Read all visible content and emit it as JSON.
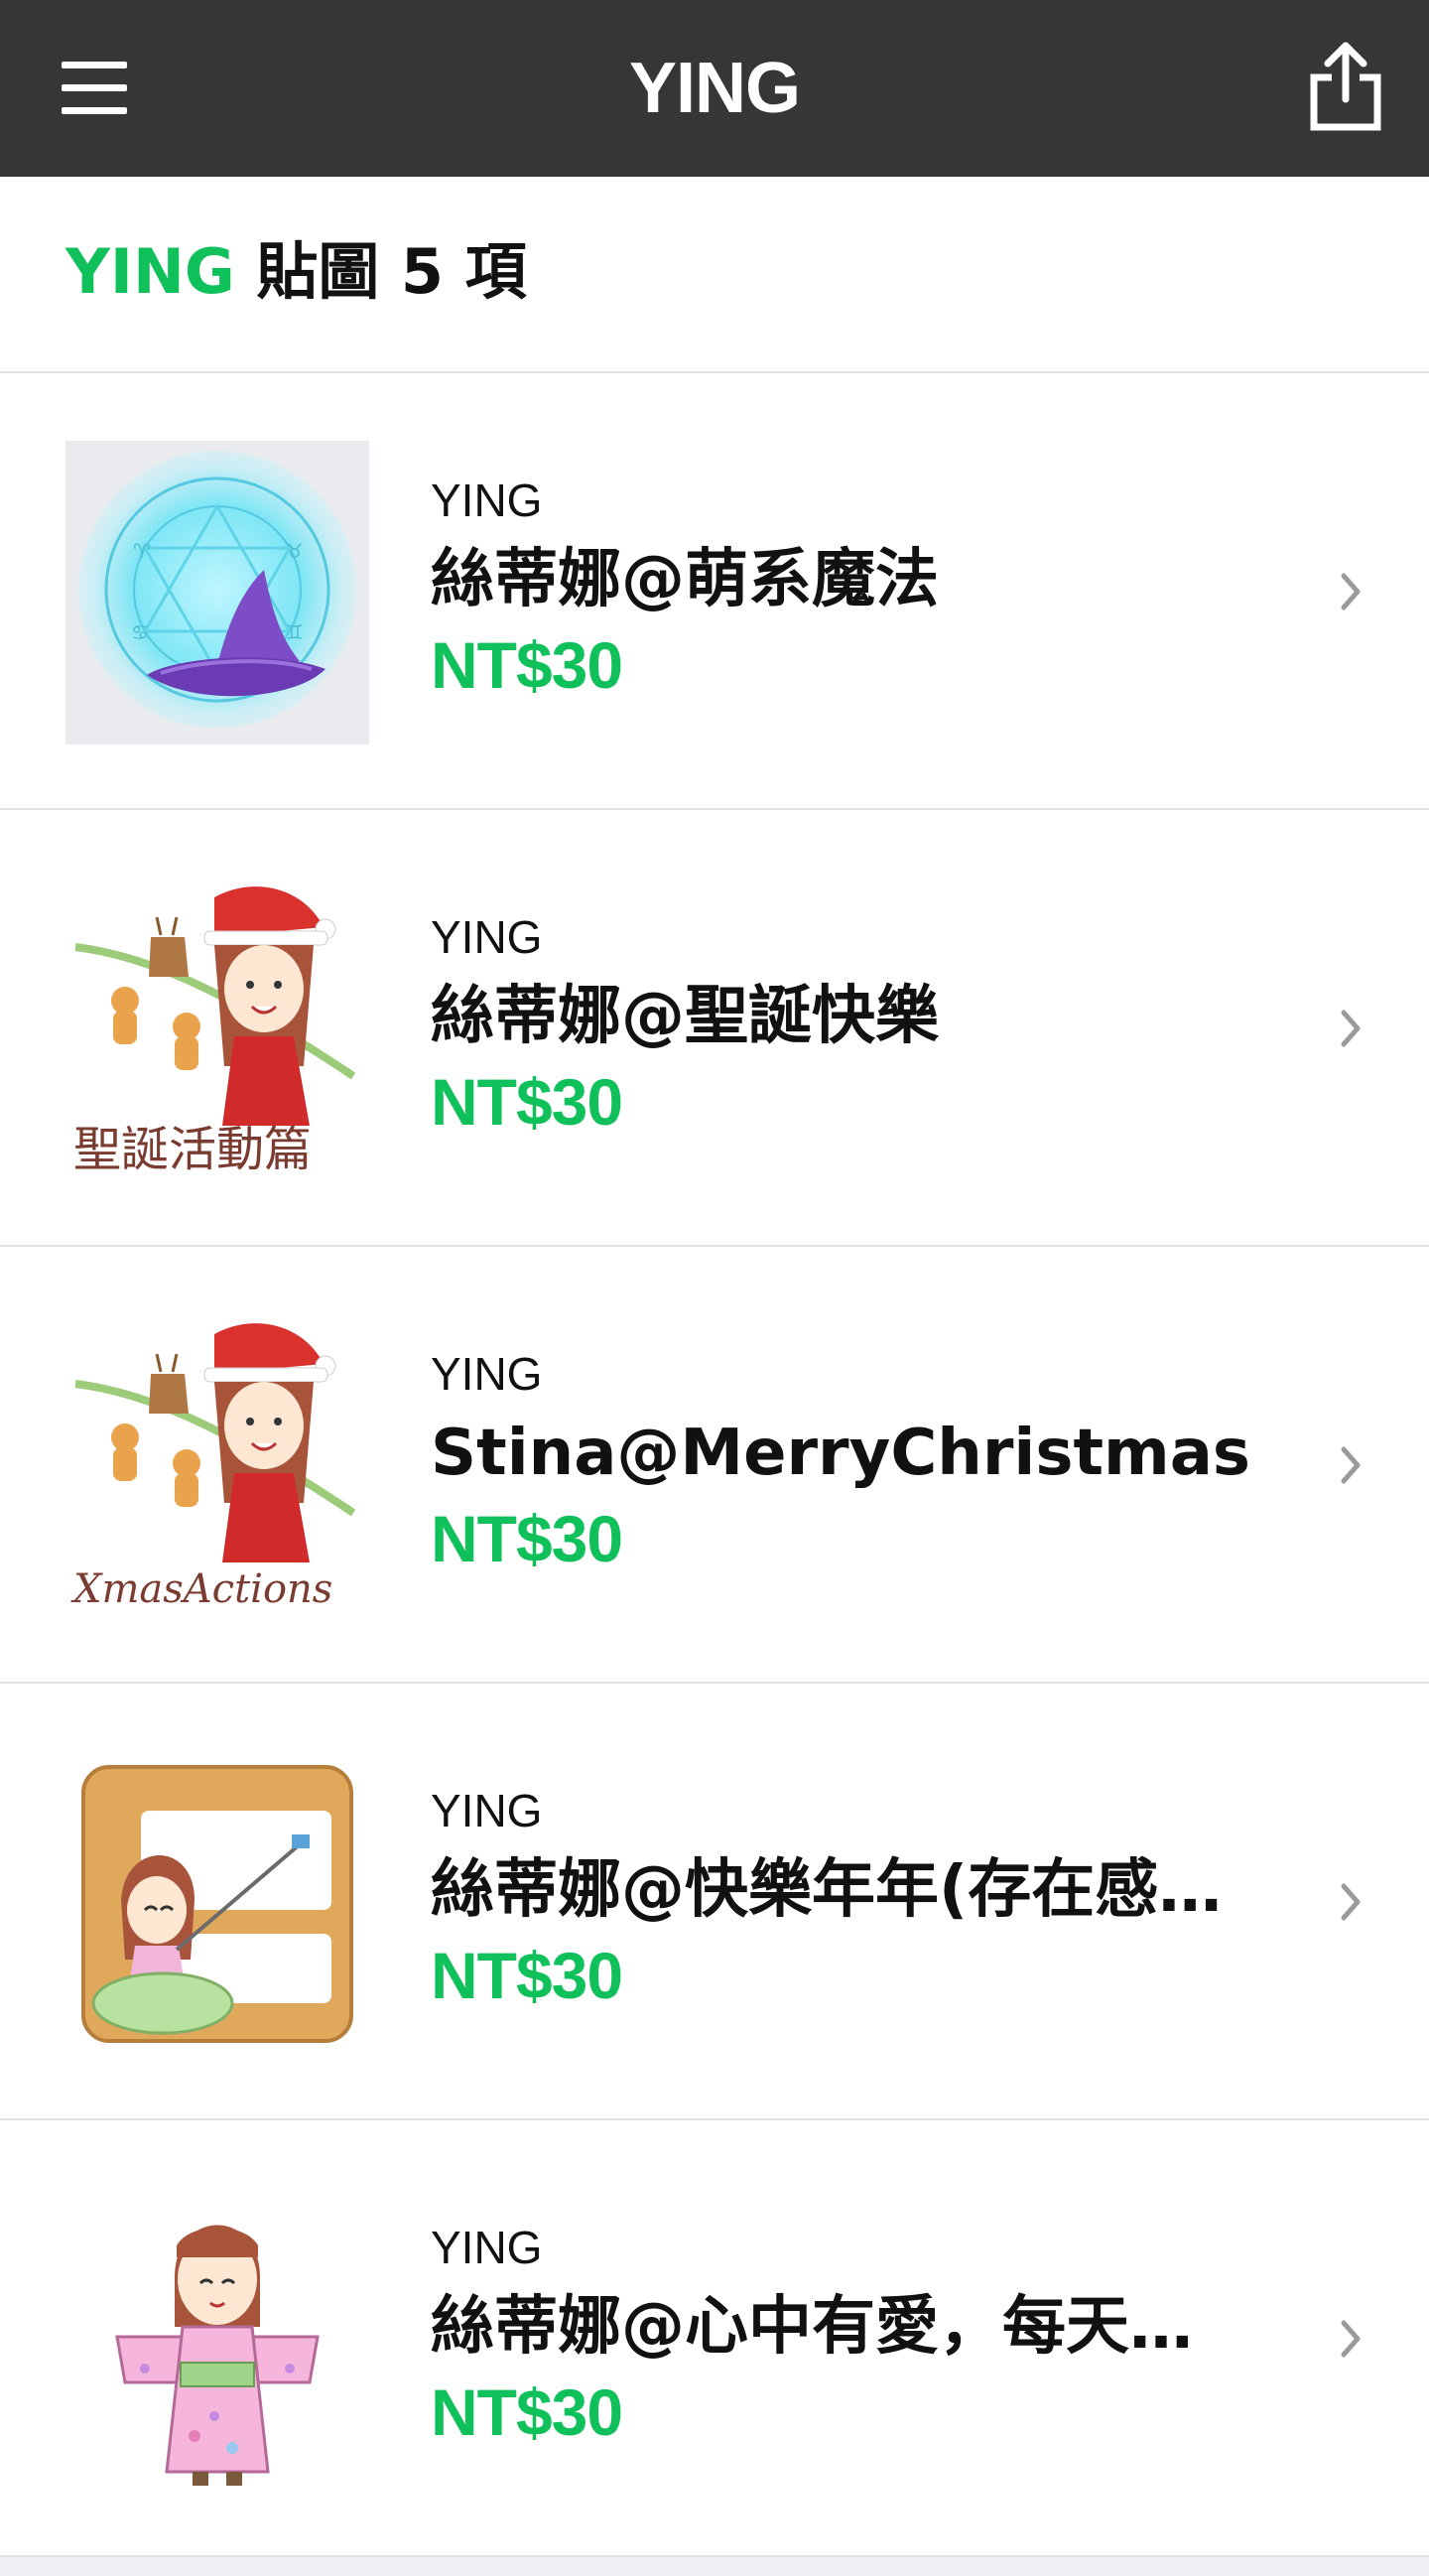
{
  "header": {
    "title": "YING",
    "menu_icon": "hamburger-menu-icon",
    "share_icon": "share-icon"
  },
  "summary": {
    "author": "YING",
    "text": "貼圖 5 項"
  },
  "items": [
    {
      "author": "YING",
      "name": "絲蒂娜@萌系魔法",
      "price": "NT$30",
      "thumbnail": "witch-hat-magic-circle"
    },
    {
      "author": "YING",
      "name": "絲蒂娜@聖誕快樂",
      "price": "NT$30",
      "thumbnail": "christmas-girl-reindeer",
      "thumbnail_caption": "聖誕活動篇"
    },
    {
      "author": "YING",
      "name": "Stina@MerryChristmas",
      "price": "NT$30",
      "thumbnail": "christmas-girl-reindeer",
      "thumbnail_caption": "XmasActions"
    },
    {
      "author": "YING",
      "name": "絲蒂娜@快樂年年(存在感…",
      "price": "NT$30",
      "thumbnail": "girl-selfie-frame"
    },
    {
      "author": "YING",
      "name": "絲蒂娜@心中有愛，每天…",
      "price": "NT$30",
      "thumbnail": "girl-pink-kimono"
    }
  ],
  "colors": {
    "header_bg": "#363636",
    "accent_green": "#10c05a",
    "divider": "#e3e3e3"
  }
}
